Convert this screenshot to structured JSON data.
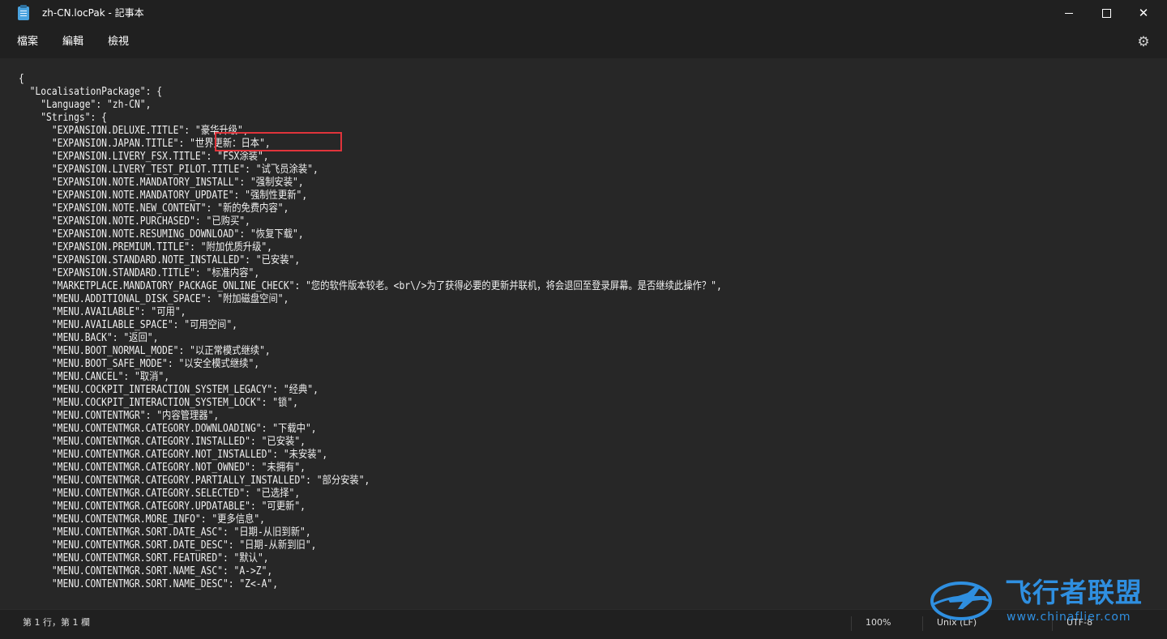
{
  "window": {
    "title": "zh-CN.locPak - 記事本",
    "minimize_symbol": "—",
    "close_symbol": "✕"
  },
  "menu": {
    "file": "檔案",
    "edit": "編輯",
    "view": "檢視",
    "settings_icon": "gear-icon"
  },
  "editor": {
    "lines": [
      "{",
      "  \"LocalisationPackage\": {",
      "    \"Language\": \"zh-CN\",",
      "    \"Strings\": {",
      "      \"EXPANSION.DELUXE.TITLE\": \"豪华升级\",",
      "      \"EXPANSION.JAPAN.TITLE\": \"世界更新：日本\",",
      "      \"EXPANSION.LIVERY_FSX.TITLE\": \"FSX涂装\",",
      "      \"EXPANSION.LIVERY_TEST_PILOT.TITLE\": \"试飞员涂装\",",
      "      \"EXPANSION.NOTE.MANDATORY_INSTALL\": \"强制安装\",",
      "      \"EXPANSION.NOTE.MANDATORY_UPDATE\": \"强制性更新\",",
      "      \"EXPANSION.NOTE.NEW_CONTENT\": \"新的免费内容\",",
      "      \"EXPANSION.NOTE.PURCHASED\": \"已购买\",",
      "      \"EXPANSION.NOTE.RESUMING_DOWNLOAD\": \"恢复下载\",",
      "      \"EXPANSION.PREMIUM.TITLE\": \"附加优质升级\",",
      "      \"EXPANSION.STANDARD.NOTE_INSTALLED\": \"已安装\",",
      "      \"EXPANSION.STANDARD.TITLE\": \"标准内容\",",
      "      \"MARKETPLACE.MANDATORY_PACKAGE_ONLINE_CHECK\": \"您的软件版本较老。<br\\/>为了获得必要的更新并联机，将会退回至登录屏幕。是否继续此操作？\",",
      "      \"MENU.ADDITIONAL_DISK_SPACE\": \"附加磁盘空间\",",
      "      \"MENU.AVAILABLE\": \"可用\",",
      "      \"MENU.AVAILABLE_SPACE\": \"可用空间\",",
      "      \"MENU.BACK\": \"返回\",",
      "      \"MENU.BOOT_NORMAL_MODE\": \"以正常模式继续\",",
      "      \"MENU.BOOT_SAFE_MODE\": \"以安全模式继续\",",
      "      \"MENU.CANCEL\": \"取消\",",
      "      \"MENU.COCKPIT_INTERACTION_SYSTEM_LEGACY\": \"经典\",",
      "      \"MENU.COCKPIT_INTERACTION_SYSTEM_LOCK\": \"锁\",",
      "      \"MENU.CONTENTMGR\": \"内容管理器\",",
      "      \"MENU.CONTENTMGR.CATEGORY.DOWNLOADING\": \"下载中\",",
      "      \"MENU.CONTENTMGR.CATEGORY.INSTALLED\": \"已安装\",",
      "      \"MENU.CONTENTMGR.CATEGORY.NOT_INSTALLED\": \"未安装\",",
      "      \"MENU.CONTENTMGR.CATEGORY.NOT_OWNED\": \"未拥有\",",
      "      \"MENU.CONTENTMGR.CATEGORY.PARTIALLY_INSTALLED\": \"部分安装\",",
      "      \"MENU.CONTENTMGR.CATEGORY.SELECTED\": \"已选择\",",
      "      \"MENU.CONTENTMGR.CATEGORY.UPDATABLE\": \"可更新\",",
      "      \"MENU.CONTENTMGR.MORE_INFO\": \"更多信息\",",
      "      \"MENU.CONTENTMGR.SORT.DATE_ASC\": \"日期-从旧到新\",",
      "      \"MENU.CONTENTMGR.SORT.DATE_DESC\": \"日期-从新到旧\",",
      "      \"MENU.CONTENTMGR.SORT.FEATURED\": \"默认\",",
      "      \"MENU.CONTENTMGR.SORT.NAME_ASC\": \"A->Z\",",
      "      \"MENU.CONTENTMGR.SORT.NAME_DESC\": \"Z<-A\","
    ]
  },
  "status": {
    "position": "第 1 行，第 1 欄",
    "zoom": "100%",
    "line_ending": "Unix (LF)",
    "encoding": "UTF-8"
  },
  "watermark": {
    "title": "飞行者联盟",
    "url": "www.chinaflier.com"
  },
  "colors": {
    "highlight_border": "#e0343b",
    "watermark_blue": "#2f8fe0"
  }
}
